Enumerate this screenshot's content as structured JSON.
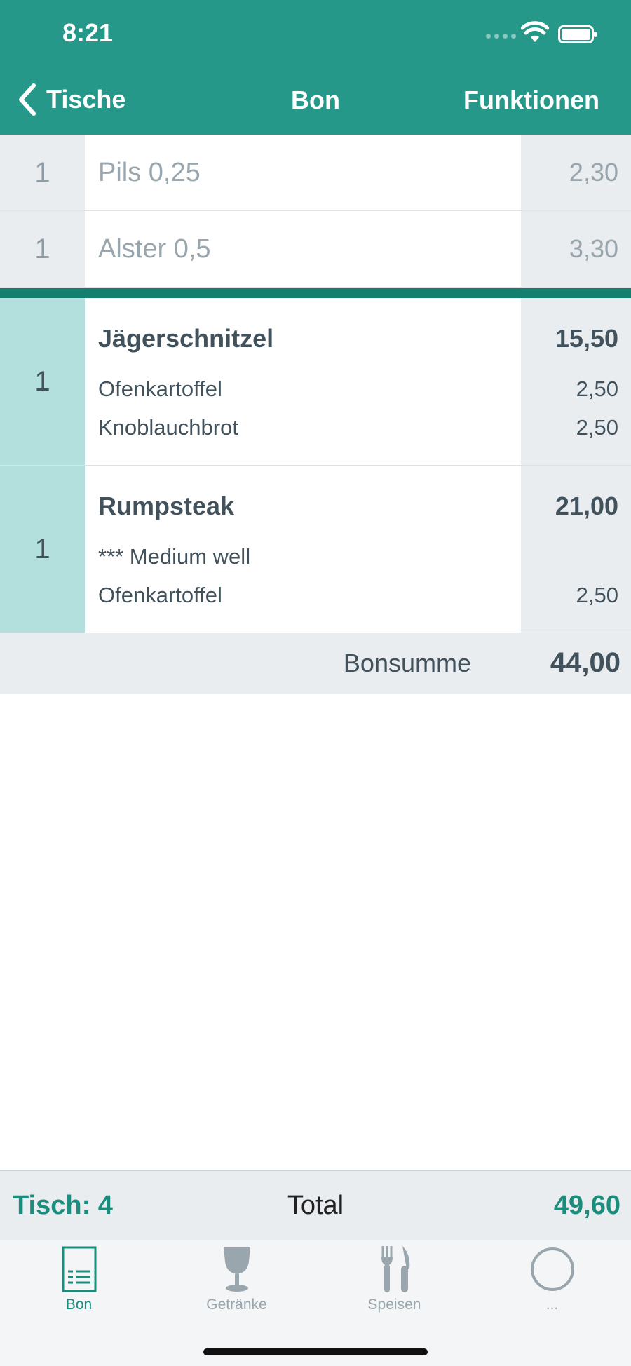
{
  "status": {
    "time": "8:21"
  },
  "nav": {
    "back_label": "Tische",
    "title": "Bon",
    "right_label": "Funktionen"
  },
  "drinks": [
    {
      "qty": "1",
      "name": "Pils 0,25",
      "price": "2,30"
    },
    {
      "qty": "1",
      "name": "Alster 0,5",
      "price": "3,30"
    }
  ],
  "foods": [
    {
      "qty": "1",
      "name": "Jägerschnitzel",
      "price": "15,50",
      "extras": [
        {
          "name": "Ofenkartoffel",
          "price": "2,50"
        },
        {
          "name": "Knoblauchbrot",
          "price": "2,50"
        }
      ]
    },
    {
      "qty": "1",
      "name": "Rumpsteak",
      "price": "21,00",
      "extras": [
        {
          "name": "*** Medium well",
          "price": ""
        },
        {
          "name": "Ofenkartoffel",
          "price": "2,50"
        }
      ]
    }
  ],
  "bonsumme": {
    "label": "Bonsumme",
    "value": "44,00"
  },
  "footer": {
    "tisch_label": "Tisch:",
    "tisch_number": "4",
    "total_label": "Total",
    "total_value": "49,60"
  },
  "tabs": [
    {
      "label": "Bon",
      "icon": "receipt-icon",
      "active": true
    },
    {
      "label": "Getränke",
      "icon": "wine-glass-icon",
      "active": false
    },
    {
      "label": "Speisen",
      "icon": "fork-knife-icon",
      "active": false
    },
    {
      "label": "...",
      "icon": "circle-icon",
      "active": false
    }
  ],
  "colors": {
    "primary": "#259889",
    "food_qty_bg": "#b3e0dc",
    "separator": "#127f6f",
    "accent_text": "#1a8d7d"
  }
}
